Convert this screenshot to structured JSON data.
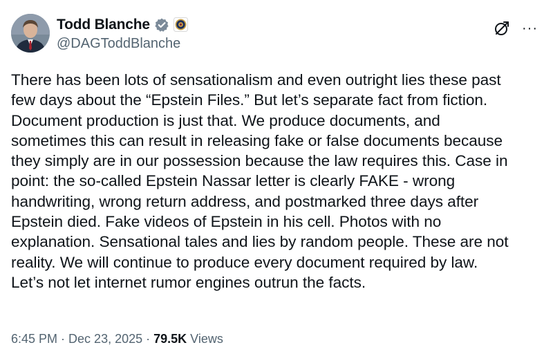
{
  "author": {
    "display_name": "Todd Blanche",
    "handle": "@DAGToddBlanche",
    "verified_badge_icon": "verified-check-icon",
    "affiliation_icon": "doj-seal-icon"
  },
  "actions": {
    "grok_icon": "grok-icon",
    "more_label": "···"
  },
  "tweet": {
    "text": "There has been lots of sensationalism and even outright lies these past\nfew days about the “Epstein Files.” But let’s separate fact from fiction.\nDocument production is just that. We produce documents, and\nsometimes this can result in releasing fake or false documents because\nthey simply are in our possession because the law requires this. Case in\npoint: the so-called Epstein Nassar letter is clearly FAKE - wrong\nhandwriting, wrong return address, and postmarked three days after\nEpstein died. Fake videos of Epstein in his cell. Photos with no\nexplanation. Sensational tales and lies by random people. These are not\nreality. We will continue to produce every document required by law.\nLet’s not let internet rumor engines outrun the facts."
  },
  "meta": {
    "time": "6:45 PM",
    "separator": " · ",
    "date": "Dec 23, 2025",
    "separator2": " · ",
    "views_count": "79.5K",
    "views_label": " Views"
  },
  "colors": {
    "text_primary": "#0f1419",
    "text_secondary": "#536471",
    "verified_blue": "#1d9bf0"
  }
}
